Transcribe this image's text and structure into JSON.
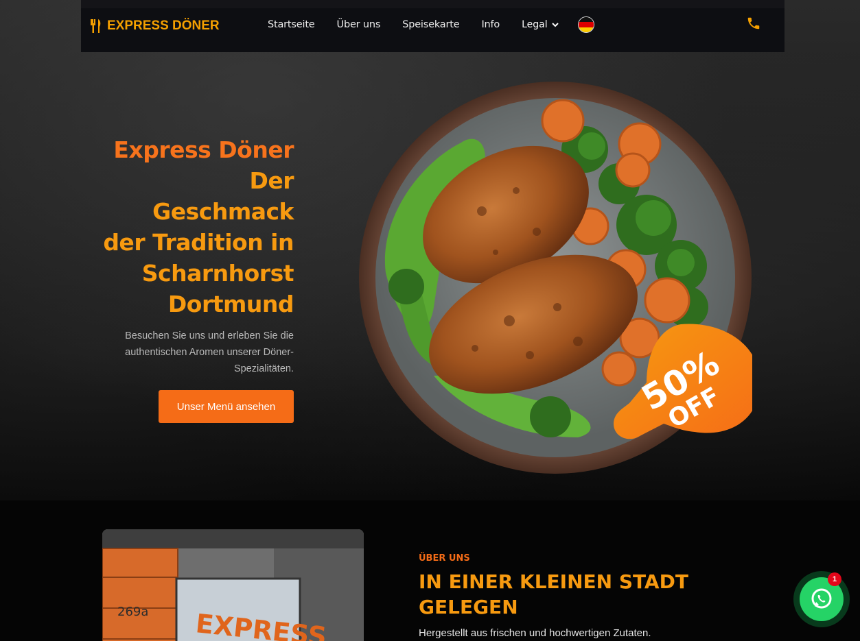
{
  "brand": {
    "name": "EXPRESS DÖNER",
    "icon": "fork-knife-icon",
    "color": "#f5a000"
  },
  "nav": {
    "links": [
      "Startseite",
      "Über uns",
      "Speisekarte",
      "Info"
    ],
    "dropdown_label": "Legal",
    "language": "German",
    "phone_icon": "phone-icon"
  },
  "hero": {
    "title_line1": "Express Döner",
    "title_rest": [
      "Der",
      "Geschmack",
      "der Tradition in",
      "Scharnhorst",
      "Dortmund"
    ],
    "description": "Besuchen Sie uns und erleben Sie die authentischen Aromen unserer Döner-Spezialitäten.",
    "button_label": "Unser Menü ansehen",
    "badge": {
      "line1": "50%",
      "line2": "OFF"
    }
  },
  "about": {
    "eyebrow": "ÜBER UNS",
    "title": "IN EINER KLEINEN STADT GELEGEN",
    "text": "Hergestellt aus frischen und hochwertigen Zutaten.",
    "image_sign": "EXPRESS",
    "image_number": "269a"
  },
  "whatsapp": {
    "badge_count": "1",
    "icon": "whatsapp-icon"
  },
  "colors": {
    "accent_orange": "#f56c17",
    "accent_amber": "#f79a10",
    "whatsapp_green": "#25d366"
  }
}
